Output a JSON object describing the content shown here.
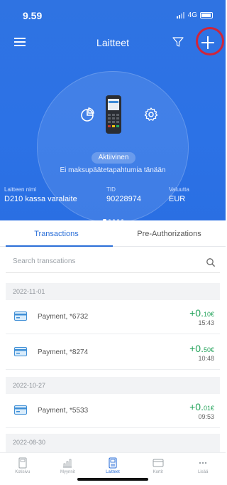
{
  "status_bar": {
    "time": "9.59",
    "network": "4G"
  },
  "nav": {
    "title": "Laitteet"
  },
  "device": {
    "status": "Aktiivinen",
    "message": "Ei maksupäätetapahtumia tänään",
    "name_label": "Laitteen nimi",
    "name_value": "D210 kassa varalaite",
    "tid_label": "TID",
    "tid_value": "90228974",
    "currency_label": "Valuutta",
    "currency_value": "EUR"
  },
  "tabs": [
    {
      "label": "Transactions",
      "active": true
    },
    {
      "label": "Pre-Authorizations",
      "active": false
    }
  ],
  "search": {
    "placeholder": "Search transcations"
  },
  "groups": [
    {
      "date": "2022-11-01"
    },
    {
      "date": "2022-10-27"
    },
    {
      "date": "2022-08-30"
    }
  ],
  "transactions": [
    {
      "label": "Payment, *6732",
      "amount_main": "+0.",
      "amount_small": "10€",
      "time": "15:43"
    },
    {
      "label": "Payment, *8274",
      "amount_main": "+0.",
      "amount_small": "50€",
      "time": "10:48"
    },
    {
      "label": "Payment, *5533",
      "amount_main": "+0.",
      "amount_small": "01€",
      "time": "09:53"
    }
  ],
  "bottom_nav": [
    {
      "label": "Kotisivu",
      "icon": "home-icon"
    },
    {
      "label": "Myynnit",
      "icon": "sales-chart-icon"
    },
    {
      "label": "Laitteet",
      "icon": "device-icon",
      "active": true
    },
    {
      "label": "Kortit",
      "icon": "card-icon"
    },
    {
      "label": "Lisää",
      "icon": "more-icon"
    }
  ],
  "colors": {
    "primary": "#2b6fd8",
    "positive": "#23a35a",
    "highlight_ring": "#d0253a"
  }
}
